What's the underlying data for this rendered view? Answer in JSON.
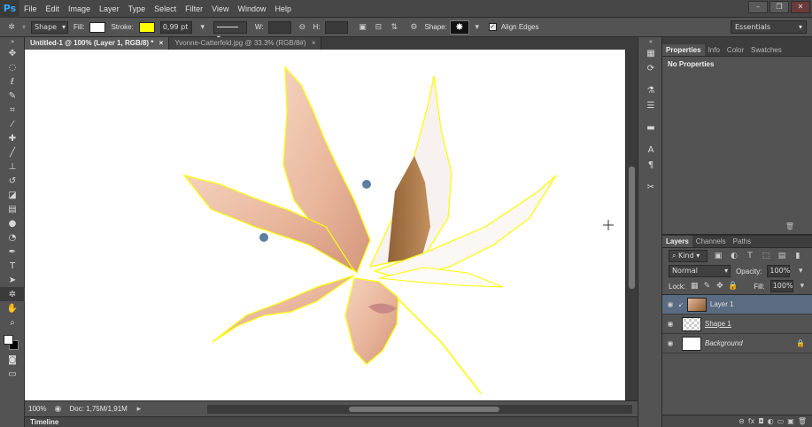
{
  "app": {
    "logo": "Ps",
    "menu": [
      "File",
      "Edit",
      "Image",
      "Layer",
      "Type",
      "Select",
      "Filter",
      "View",
      "Window",
      "Help"
    ],
    "window_controls": [
      "–",
      "❐",
      "✕"
    ]
  },
  "options": {
    "mode_label": "Shape",
    "fill_label": "Fill:",
    "stroke_label": "Stroke:",
    "stroke_width": "0,99 pt",
    "w_label": "W:",
    "h_label": "H:",
    "shape_label": "Shape:",
    "align_edges": "Align Edges",
    "workspace": "Essentials",
    "fill_color": "#ffffff",
    "stroke_color": "#ffff00"
  },
  "documents": {
    "tabs": [
      {
        "label": "Untitled-1 @ 100% (Layer 1, RGB/8) *",
        "close": "×"
      },
      {
        "label": "Yvonne-Catterfeld.jpg @ 33.3% (RGB/8#)",
        "close": "×"
      }
    ]
  },
  "status": {
    "zoom": "100%",
    "doc": "Doc: 1,75M/1,91M",
    "timeline": "Timeline"
  },
  "properties": {
    "tabs": [
      "Properties",
      "Info",
      "Color",
      "Swatches"
    ],
    "content": "No Properties"
  },
  "layers": {
    "tabs": [
      "Layers",
      "Channels",
      "Paths"
    ],
    "filter": "Kind",
    "blend_mode": "Normal",
    "opacity_label": "Opacity:",
    "opacity": "100%",
    "lock_label": "Lock:",
    "fill_label": "Fill:",
    "fill": "100%",
    "items": [
      {
        "name": "Layer 1"
      },
      {
        "name": "Shape 1"
      },
      {
        "name": "Background"
      }
    ]
  },
  "colors": {
    "accent": "#31a8ff",
    "selected_layer": "#5a6b82",
    "leaf_outline": "#ffff00"
  }
}
